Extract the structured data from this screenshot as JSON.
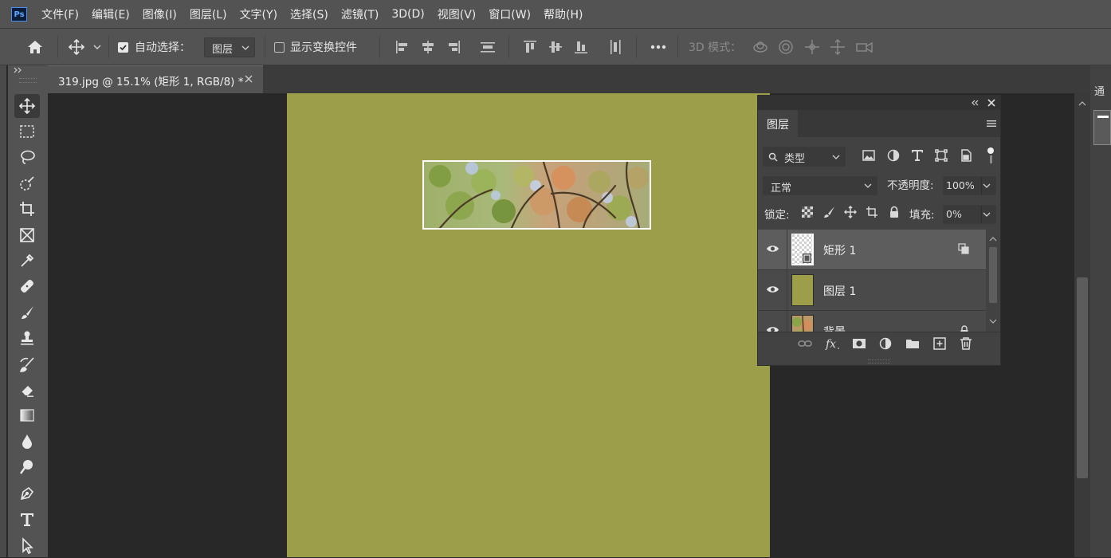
{
  "app": {
    "logo": "Ps",
    "menu": [
      "文件(F)",
      "编辑(E)",
      "图像(I)",
      "图层(L)",
      "文字(Y)",
      "选择(S)",
      "滤镜(T)",
      "3D(D)",
      "视图(V)",
      "窗口(W)",
      "帮助(H)"
    ]
  },
  "options_bar": {
    "auto_select_label": "自动选择：",
    "auto_select_checked": true,
    "auto_select_target": "图层",
    "show_transform_label": "显示变换控件",
    "show_transform_checked": false,
    "mode_3d_label": "3D 模式："
  },
  "document": {
    "tab_title": "319.jpg @ 15.1% (矩形 1, RGB/8) *",
    "canvas_color": "#9d9e4a"
  },
  "right_strip": {
    "label": "通"
  },
  "layers_panel": {
    "tab_label": "图层",
    "filter_label": "类型",
    "blend_mode": "正常",
    "opacity_label": "不透明度:",
    "opacity_value": "100%",
    "lock_label": "锁定:",
    "fill_label": "填充:",
    "fill_value": "0%",
    "layers": [
      {
        "name": "矩形 1",
        "visible": true,
        "selected": true,
        "type": "shape"
      },
      {
        "name": "图层 1",
        "visible": true,
        "selected": false,
        "type": "fill",
        "color": "#9d9e4a"
      },
      {
        "name": "背景",
        "visible": true,
        "selected": false,
        "type": "image",
        "locked": true
      }
    ]
  }
}
